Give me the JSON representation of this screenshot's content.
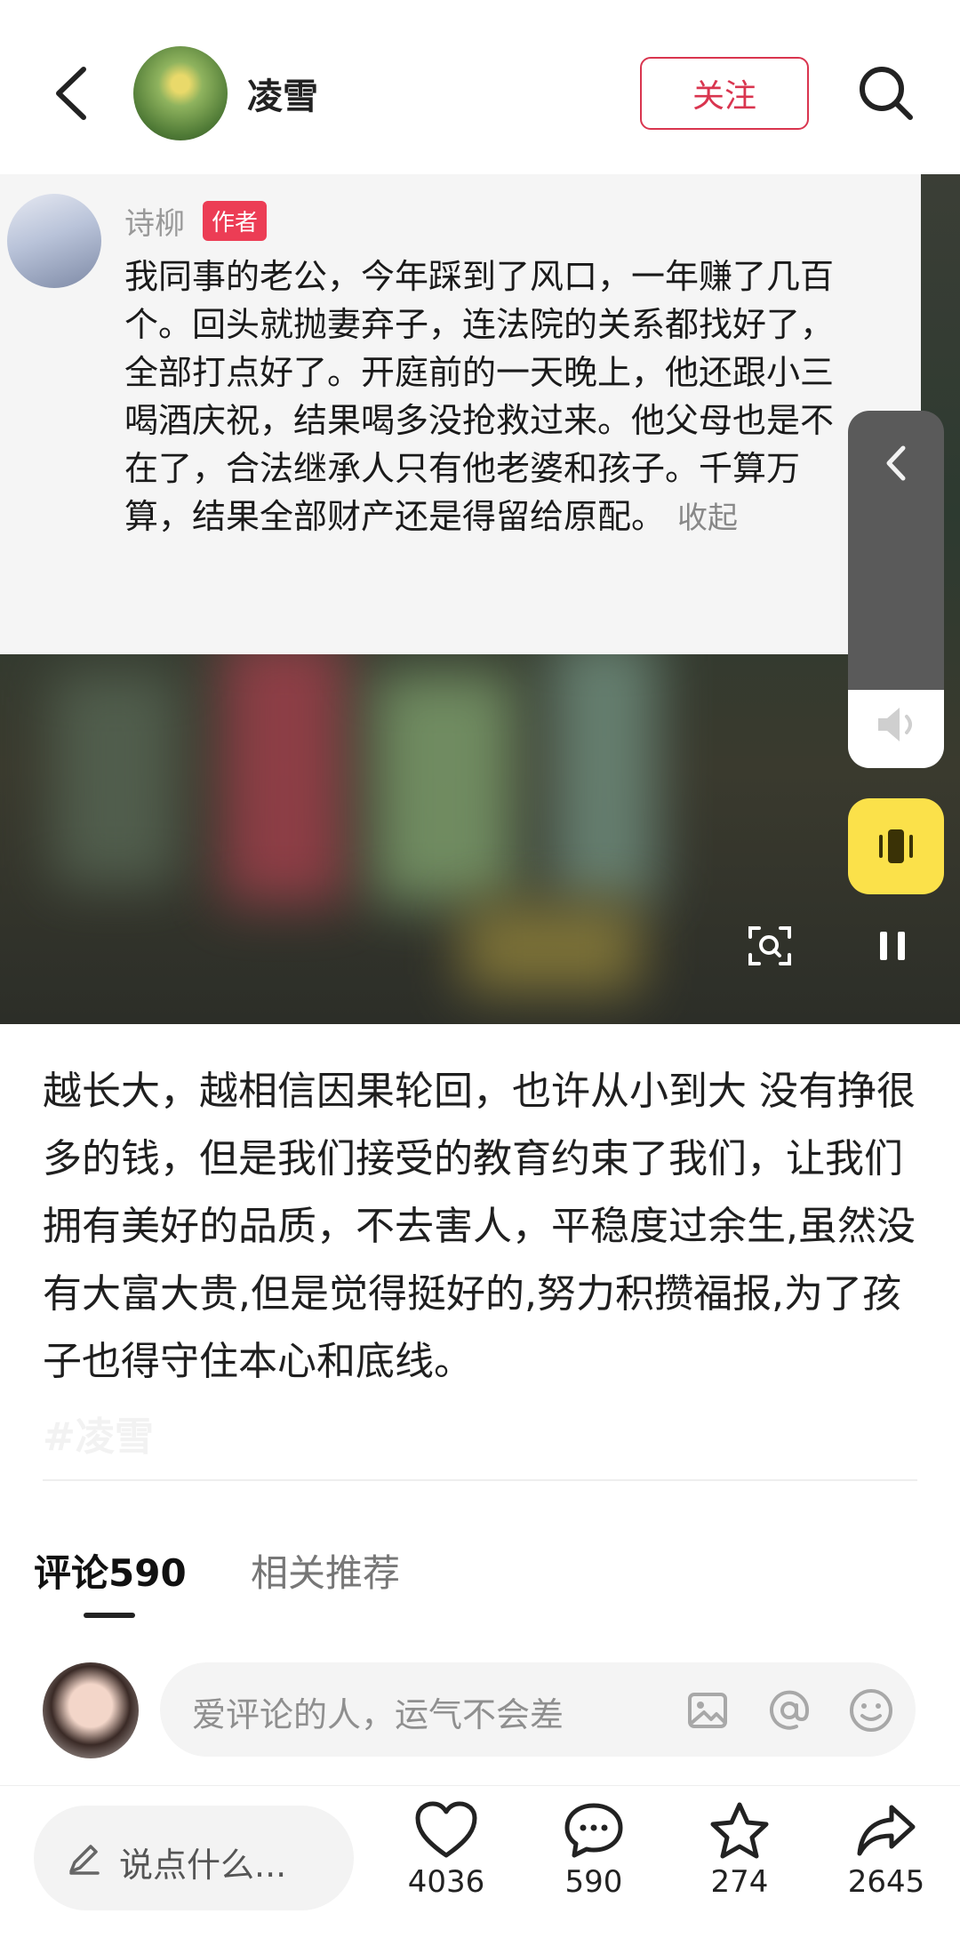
{
  "header": {
    "author_name": "凌雪",
    "follow_label": "关注"
  },
  "video": {
    "comment": {
      "username": "诗柳",
      "badge": "作者",
      "text": "我同事的老公，今年踩到了风口，一年赚了几百个。回头就抛妻弃子，连法院的关系都找好了，全部打点好了。开庭前的一天晚上，他还跟小三喝酒庆祝，结果喝多没抢救过来。他父母也是不在了，合法继承人只有他老婆和孩子。千算万算，结果全部财产还是得留给原配。",
      "collapse_label": "收起"
    },
    "volume_level": 0.22
  },
  "post": {
    "text": "越长大，越相信因果轮回，也许从小到大  没有挣很多的钱，但是我们接受的教育约束了我们，让我们拥有美好的品质，不去害人，平稳度过余生,虽然没有大富大贵,但是觉得挺好的,努力积攒福报,为了孩子也得守住本心和底线。",
    "faded_text": "#凌雪"
  },
  "tabs": [
    {
      "label": "评论590"
    },
    {
      "label": "相关推荐"
    }
  ],
  "comment_input": {
    "placeholder": "爱评论的人，运气不会差"
  },
  "bottom_bar": {
    "say_placeholder": "说点什么...",
    "like_count": "4036",
    "comment_count": "590",
    "favorite_count": "274",
    "share_count": "2645"
  },
  "colors": {
    "accent": "#d9354f",
    "badge": "#ec3d55",
    "vibrate": "#fbe14a"
  }
}
